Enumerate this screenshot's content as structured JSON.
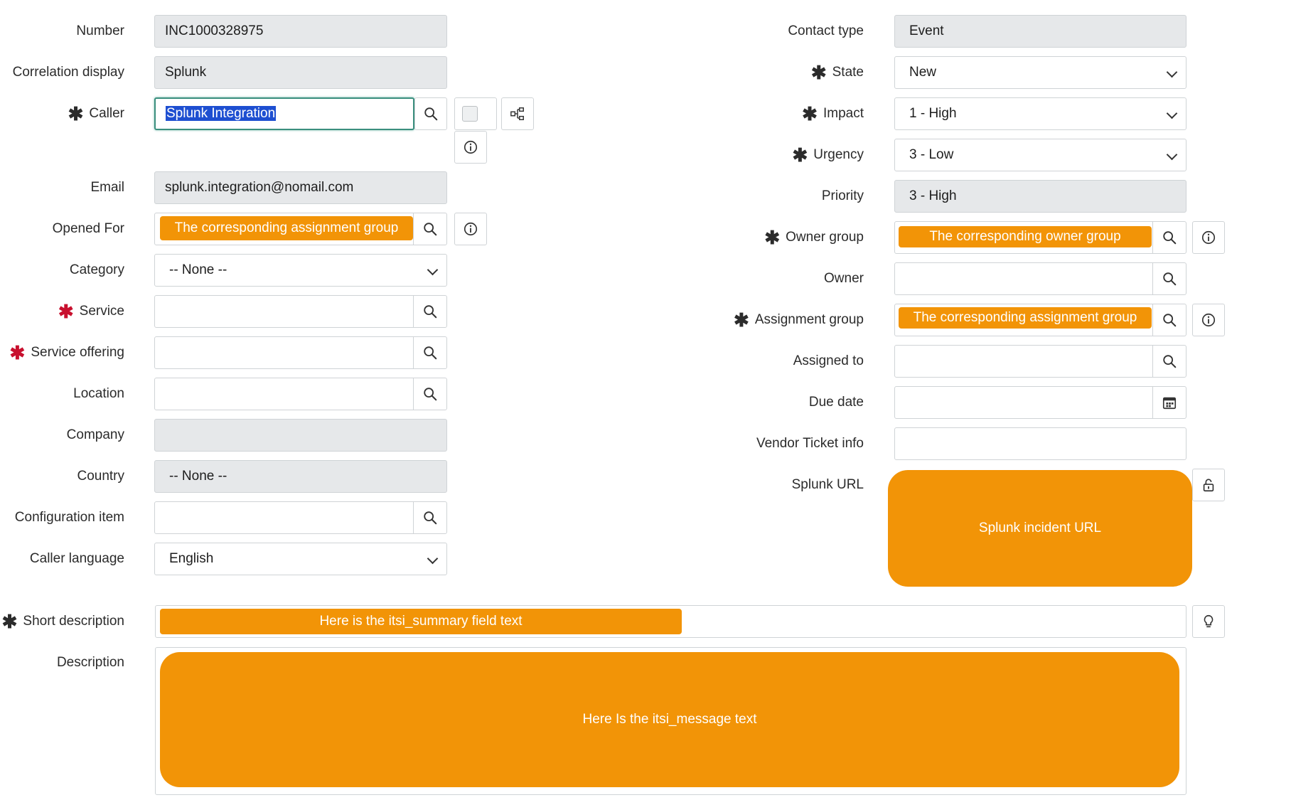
{
  "left": {
    "number": {
      "label": "Number",
      "value": "INC1000328975"
    },
    "correlation": {
      "label": "Correlation display",
      "value": "Splunk"
    },
    "caller": {
      "label": "Caller",
      "value": "Splunk Integration"
    },
    "email": {
      "label": "Email",
      "value": "splunk.integration@nomail.com"
    },
    "opened_for": {
      "label": "Opened For",
      "value": "The corresponding assignment group"
    },
    "category": {
      "label": "Category",
      "value": "-- None --"
    },
    "service": {
      "label": "Service",
      "value": ""
    },
    "service_offering": {
      "label": "Service offering",
      "value": ""
    },
    "location": {
      "label": "Location",
      "value": ""
    },
    "company": {
      "label": "Company",
      "value": ""
    },
    "country": {
      "label": "Country",
      "value": "-- None --"
    },
    "config_item": {
      "label": "Configuration item",
      "value": ""
    },
    "caller_language": {
      "label": "Caller language",
      "value": "English"
    }
  },
  "right": {
    "contact_type": {
      "label": "Contact type",
      "value": "Event"
    },
    "state": {
      "label": "State",
      "value": "New"
    },
    "impact": {
      "label": "Impact",
      "value": "1 - High"
    },
    "urgency": {
      "label": "Urgency",
      "value": "3 - Low"
    },
    "priority": {
      "label": "Priority",
      "value": "3 - High"
    },
    "owner_group": {
      "label": "Owner group",
      "value": "The corresponding owner group"
    },
    "owner": {
      "label": "Owner",
      "value": ""
    },
    "assignment_group": {
      "label": "Assignment group",
      "value": "The corresponding assignment group"
    },
    "assigned_to": {
      "label": "Assigned to",
      "value": ""
    },
    "due_date": {
      "label": "Due date",
      "value": ""
    },
    "vendor_ticket": {
      "label": "Vendor Ticket info",
      "value": ""
    },
    "splunk_url": {
      "label": "Splunk URL",
      "value": "Splunk incident URL"
    }
  },
  "bottom": {
    "short_description": {
      "label": "Short description",
      "value": "Here is the itsi_summary field text"
    },
    "description": {
      "label": "Description",
      "value": "Here Is the itsi_message text"
    }
  },
  "required_marker": "✱",
  "colors": {
    "accent": "#f29407",
    "required_red": "#c8102e",
    "readonly_bg": "#e6e8ea",
    "focus_border": "#3b8f7e"
  }
}
